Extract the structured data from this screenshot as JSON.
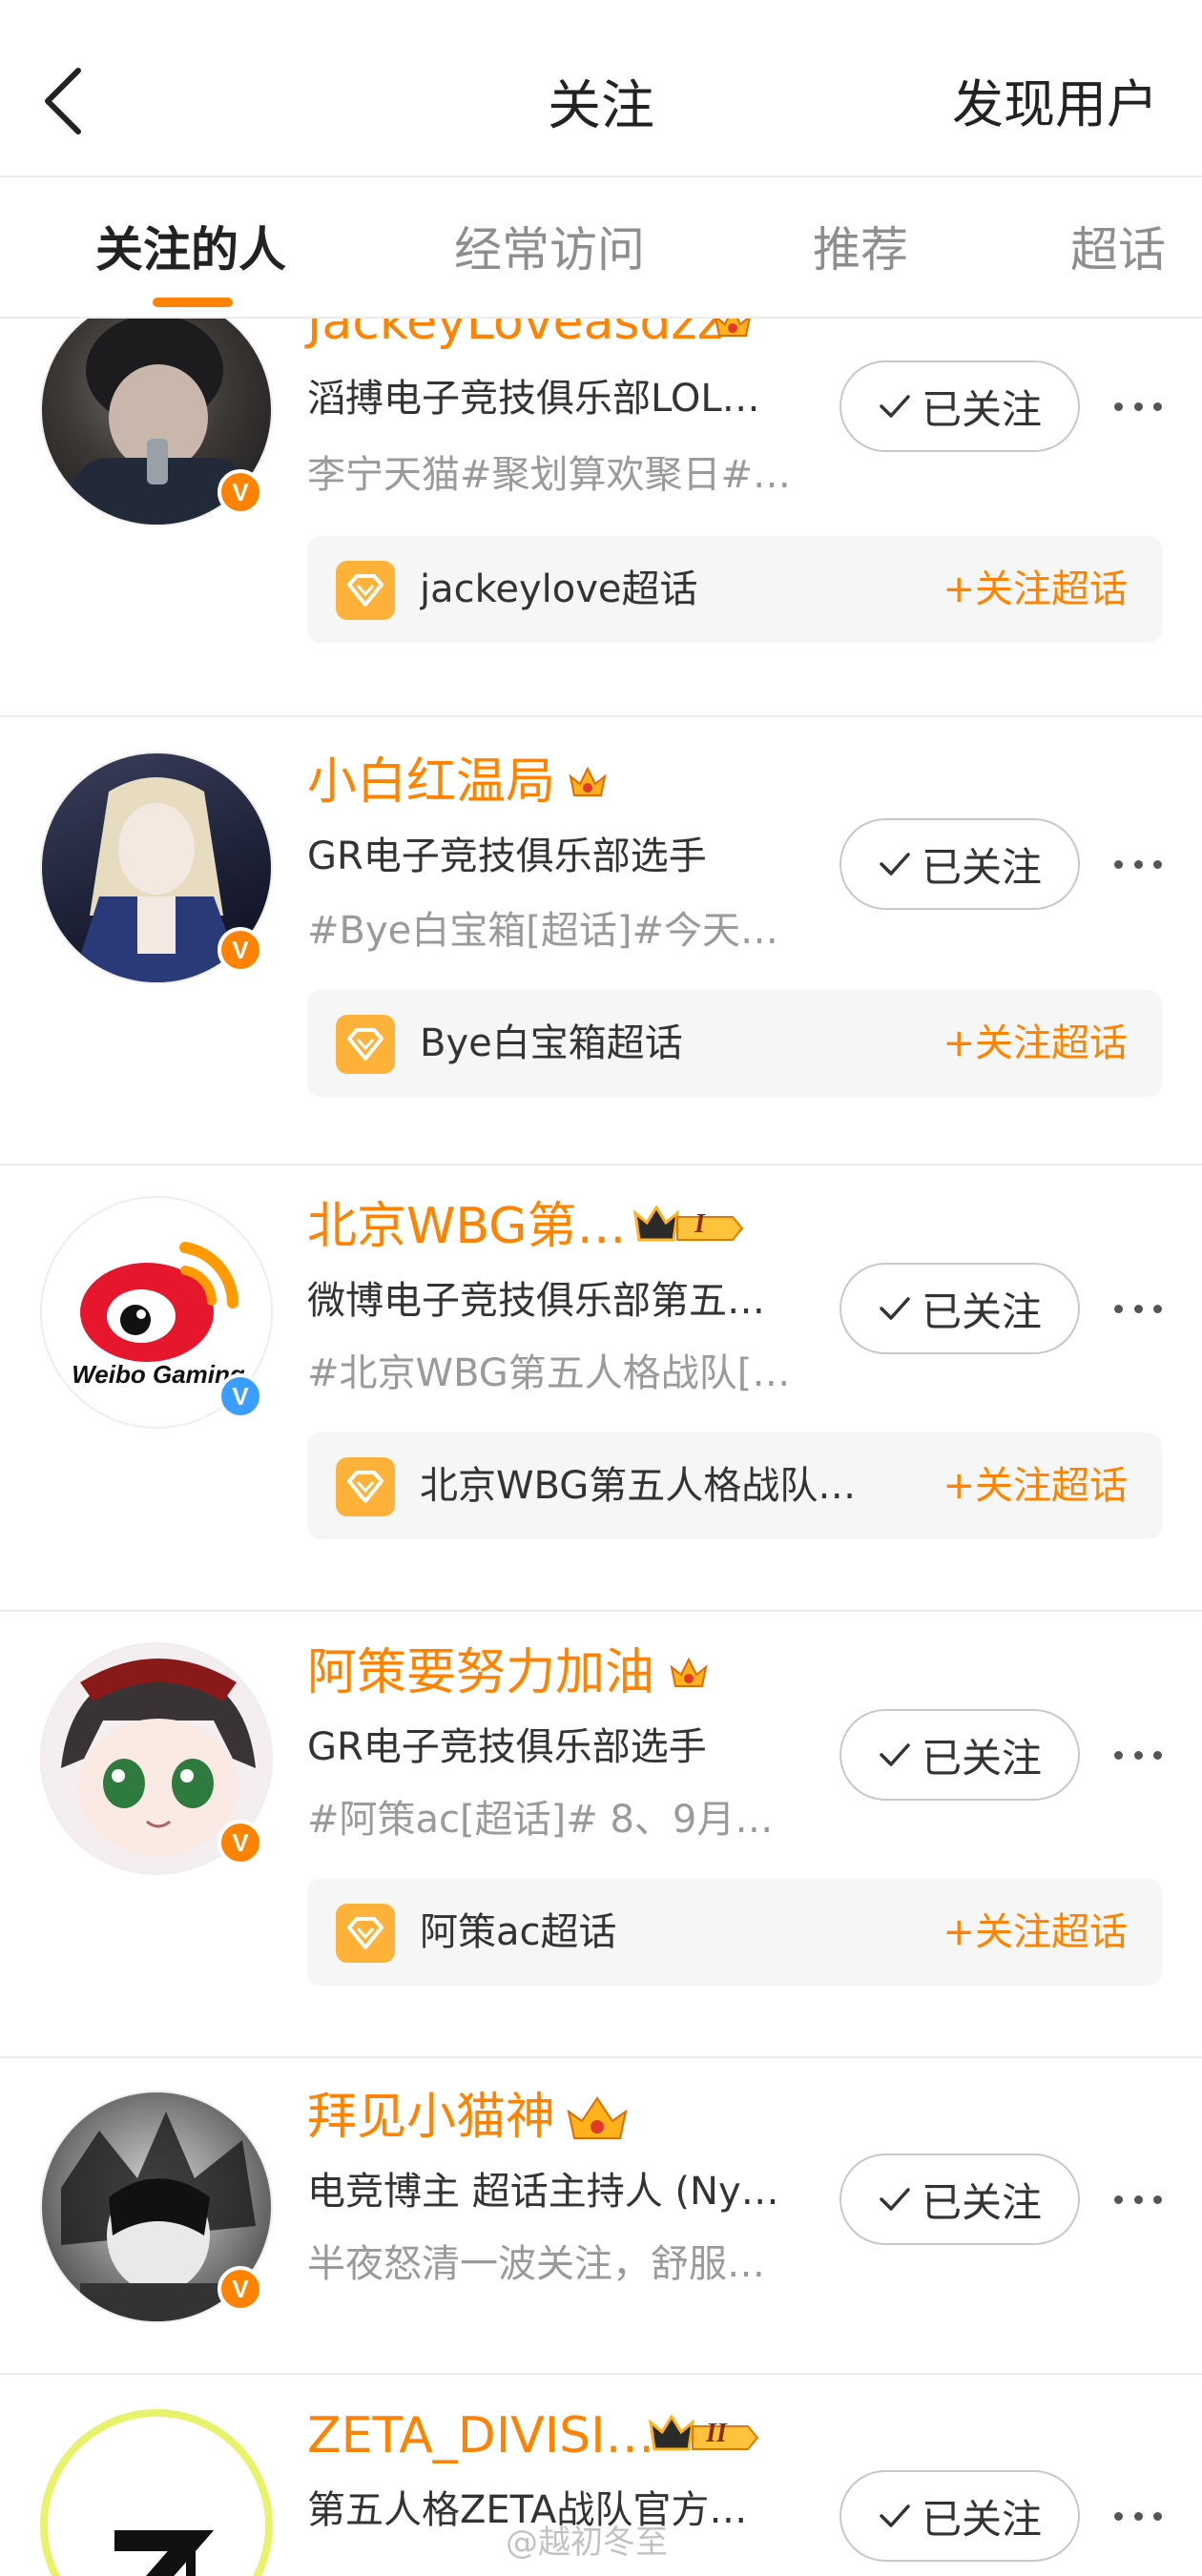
{
  "header": {
    "title": "关注",
    "discover_label": "发现用户"
  },
  "tabs": [
    {
      "label": "关注的人",
      "active": true
    },
    {
      "label": "经常访问",
      "active": false
    },
    {
      "label": "推荐",
      "active": false
    },
    {
      "label": "超话",
      "active": false
    }
  ],
  "accent_color": "#ff8200",
  "users": [
    {
      "name": "JackeyLoveasdzz",
      "desc": "滔搏电子竞技俱乐部LOL…",
      "subdesc": "李宁天猫#聚划算欢聚日#…",
      "follow_label": "已关注",
      "verified": "orange",
      "topic": {
        "name": "jackeylove超话",
        "follow_label": "+关注超话"
      }
    },
    {
      "name": "小白红温局",
      "desc": "GR电子竞技俱乐部选手",
      "subdesc": "#Bye白宝箱[超话]#今天…",
      "follow_label": "已关注",
      "verified": "orange",
      "topic": {
        "name": "Bye白宝箱超话",
        "follow_label": "+关注超话"
      }
    },
    {
      "name": "北京WBG第…",
      "desc": "微博电子竞技俱乐部第五…",
      "subdesc": "#北京WBG第五人格战队[…",
      "follow_label": "已关注",
      "verified": "blue",
      "avatar_text": "Weibo Gaming",
      "rank_badge": "I",
      "topic": {
        "name": "北京WBG第五人格战队…",
        "follow_label": "+关注超话"
      }
    },
    {
      "name": "阿策要努力加油",
      "desc": "GR电子竞技俱乐部选手",
      "subdesc": "#阿策ac[超话]# 8、9月…",
      "follow_label": "已关注",
      "verified": "orange",
      "topic": {
        "name": "阿策ac超话",
        "follow_label": "+关注超话"
      }
    },
    {
      "name": "拜见小猫神",
      "desc": "电竞博主 超话主持人 (Ny…",
      "subdesc": "半夜怒清一波关注，舒服…",
      "follow_label": "已关注",
      "verified": "orange"
    },
    {
      "name": "ZETA_DIVISI…",
      "desc": "第五人格ZETA战队官方…",
      "follow_label": "已关注",
      "rank_badge": "II"
    }
  ],
  "watermark": "@越初冬至"
}
